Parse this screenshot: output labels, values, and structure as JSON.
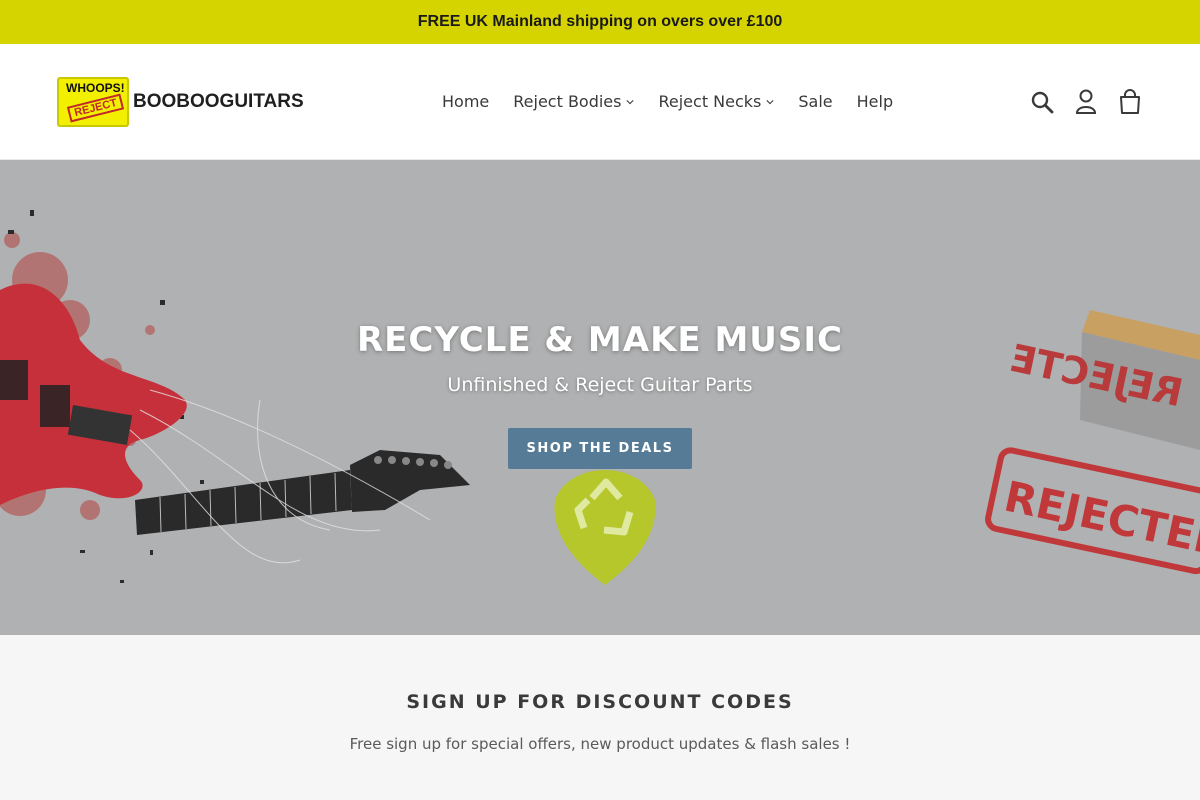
{
  "announcement": {
    "text": "FREE UK Mainland shipping on overs over £100"
  },
  "brand": {
    "badge_top": "WHOOPS!",
    "badge_stamp": "REJECT",
    "name": "BOOBOOGUITARS",
    "colors": {
      "badge": "#f2ef00",
      "stamp": "#c0282a"
    }
  },
  "nav": {
    "items": [
      {
        "label": "Home"
      },
      {
        "label": "Reject Bodies"
      },
      {
        "label": "Reject Necks"
      },
      {
        "label": "Sale"
      },
      {
        "label": "Help"
      }
    ]
  },
  "header_icons": [
    "search-icon",
    "account-icon",
    "cart-icon"
  ],
  "hero": {
    "title": "RECYCLE & MAKE MUSIC",
    "subtitle": "Unfinished & Reject Guitar Parts",
    "button_label": "SHOP THE DEALS",
    "stamp_text": "REJECTED",
    "stamp_mirrored_text": "REJECTE",
    "colors": {
      "background": "#b0b1b2",
      "button": "#557b97",
      "guitar": "#c6303a",
      "pick": "#b5c72a"
    }
  },
  "signup": {
    "title": "SIGN UP FOR DISCOUNT CODES",
    "text": "Free sign up for special offers, new product updates & flash sales !"
  },
  "colors": {
    "announcement_bg": "#d6d400",
    "signup_bg": "#f5f6f5"
  }
}
